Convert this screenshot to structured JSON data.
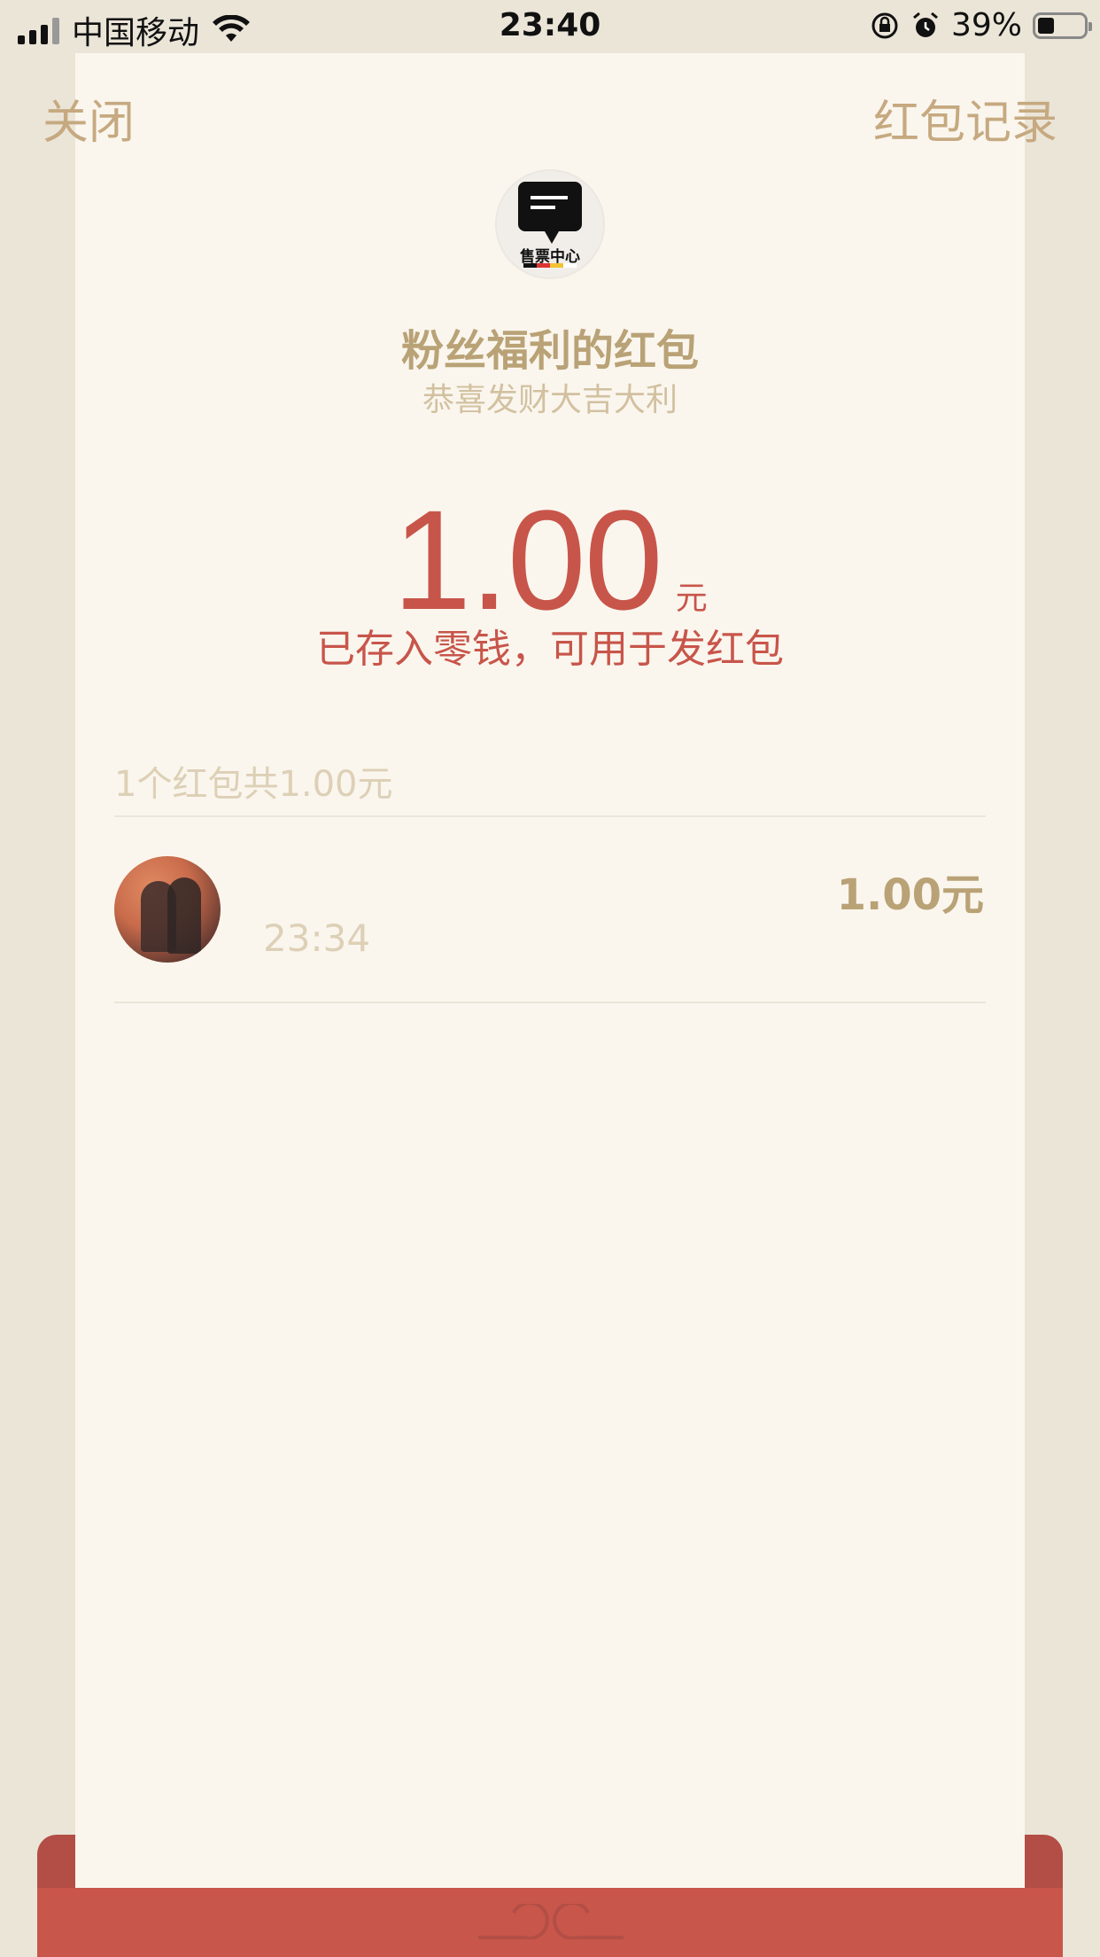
{
  "status_bar": {
    "carrier": "中国移动",
    "time": "23:40",
    "battery": "39%"
  },
  "nav": {
    "close_label": "关闭",
    "records_label": "红包记录"
  },
  "sender": {
    "logo_text": "售票中心",
    "title": "粉丝福利的红包",
    "wish": "恭喜发财大吉大利"
  },
  "received": {
    "amount": "1.00",
    "unit": "元",
    "note": "已存入零钱，可用于发红包"
  },
  "list": {
    "summary": "1个红包共1.00元",
    "items": [
      {
        "amount": "1.00元",
        "time": "23:34"
      }
    ]
  },
  "colors": {
    "accent_red": "#c8554a",
    "gold": "#b9a276",
    "background": "#faf6ee"
  }
}
